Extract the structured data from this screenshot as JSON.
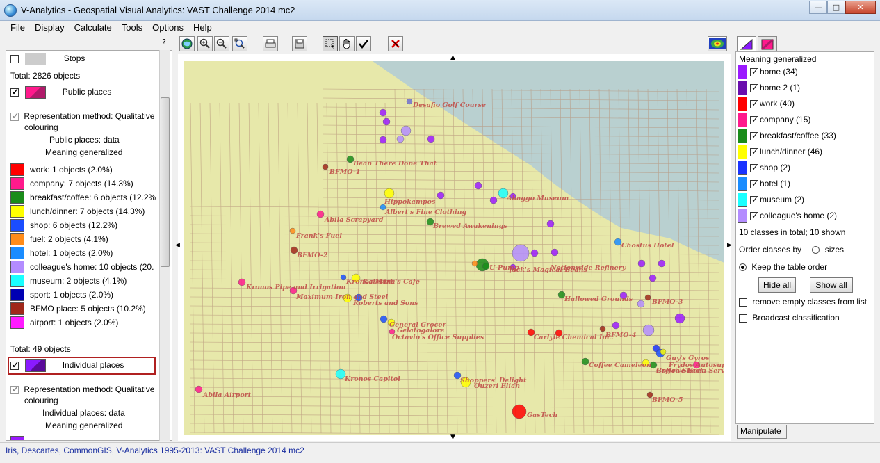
{
  "window": {
    "title": "V-Analytics - Geospatial Visual Analytics: VAST Challenge 2014 mc2",
    "controls": [
      "—",
      "□",
      "✕"
    ]
  },
  "menu": [
    "File",
    "Display",
    "Calculate",
    "Tools",
    "Options",
    "Help"
  ],
  "toolbar": {
    "help_label": "?",
    "buttons": [
      "globe-icon",
      "zoom-in-icon",
      "zoom-out-icon",
      "zoom-extent-icon",
      "print-icon",
      "save-icon",
      "select-rect-icon",
      "pan-hand-icon",
      "checkmark-icon",
      "no-select-icon",
      "overview-map-icon"
    ]
  },
  "left_panel": {
    "stops_label": "Stops",
    "stops_total": "Total: 2826 objects",
    "public_places_label": "Public places",
    "public_rep_method": "Representation method: Qualitative",
    "public_rep_method2": "colouring",
    "public_data": "Public places: data",
    "public_attr": "Meaning generalized",
    "public_legend": [
      {
        "color": "#ff0000",
        "label": "work: 1 objects (2.0%)"
      },
      {
        "color": "#ff1a8c",
        "label": "company: 7 objects (14.3%)"
      },
      {
        "color": "#1a8c1a",
        "label": "breakfast/coffee: 6 objects (12.2%"
      },
      {
        "color": "#ffff00",
        "label": "lunch/dinner: 7 objects (14.3%)"
      },
      {
        "color": "#1a4dff",
        "label": "shop: 6 objects (12.2%)"
      },
      {
        "color": "#ff8c1a",
        "label": "fuel: 2 objects (4.1%)"
      },
      {
        "color": "#1a8cff",
        "label": "hotel: 1 objects (2.0%)"
      },
      {
        "color": "#b38cff",
        "label": "colleague's home: 10 objects (20."
      },
      {
        "color": "#1affff",
        "label": "museum: 2 objects (4.1%)"
      },
      {
        "color": "#0000b3",
        "label": "sport: 1 objects (2.0%)"
      },
      {
        "color": "#a0281a",
        "label": "BFMO place: 5 objects (10.2%)"
      },
      {
        "color": "#ff1aff",
        "label": "airport: 1 objects (2.0%)"
      }
    ],
    "public_total": "Total: 49 objects",
    "individual_places_label": "Individual places",
    "indiv_rep_method": "Representation method: Qualitative",
    "indiv_rep_method2": "colouring",
    "indiv_data": "Individual places: data",
    "indiv_attr": "Meaning generalized"
  },
  "right_panel": {
    "title": "Meaning generalized",
    "classes": [
      {
        "color": "#9b1aff",
        "label": "home (34)"
      },
      {
        "color": "#6a0dad",
        "label": "home 2 (1)"
      },
      {
        "color": "#ff0000",
        "label": "work (40)"
      },
      {
        "color": "#ff1a8c",
        "label": "company (15)"
      },
      {
        "color": "#1a8c1a",
        "label": "breakfast/coffee (33)"
      },
      {
        "color": "#ffff00",
        "label": "lunch/dinner (46)"
      },
      {
        "color": "#1a33ff",
        "label": "shop (2)"
      },
      {
        "color": "#1a8cff",
        "label": "hotel (1)"
      },
      {
        "color": "#1affff",
        "label": "museum (2)"
      },
      {
        "color": "#b38cff",
        "label": "colleague's home (2)"
      }
    ],
    "summary": "10 classes in total; 10 shown",
    "order_label": "Order classes by",
    "sizes_label": "sizes",
    "keep_order_label": "Keep the table order",
    "hide_all": "Hide all",
    "show_all": "Show all",
    "remove_empty": "remove empty classes from list",
    "broadcast": "Broadcast classification",
    "manipulate_tab": "Manipulate"
  },
  "map": {
    "labels": [
      {
        "text": "Desafio Golf Course"
      },
      {
        "text": "Bean There Done That"
      },
      {
        "text": "BFMO-1"
      },
      {
        "text": "Hippokampos"
      },
      {
        "text": "Albert's Fine Clothing"
      },
      {
        "text": "Ahaggo Museum"
      },
      {
        "text": "Abila Scrapyard"
      },
      {
        "text": "Brewed Awakenings"
      },
      {
        "text": "Frank's Fuel"
      },
      {
        "text": "BFMO-2"
      },
      {
        "text": "Chostus Hotel"
      },
      {
        "text": "U-Pump"
      },
      {
        "text": "Jack's Magical Beans"
      },
      {
        "text": "Kronos Pipe and Irrigation"
      },
      {
        "text": "Maximum Iron and Steel"
      },
      {
        "text": "Kronos Mart"
      },
      {
        "text": "Katerina's Cafe"
      },
      {
        "text": "Nationwide Refinery"
      },
      {
        "text": "Roberts and Sons"
      },
      {
        "text": "Hallowed Grounds"
      },
      {
        "text": "BFMO-3"
      },
      {
        "text": "General Grocer"
      },
      {
        "text": "Gelatogalore"
      },
      {
        "text": "Octavio's Office Supplies"
      },
      {
        "text": "Carlyle Chemical Inc."
      },
      {
        "text": "BFMO-4"
      },
      {
        "text": "Guy's Gyros"
      },
      {
        "text": "Coffee Cameleon"
      },
      {
        "text": "Ouzeri Elian"
      },
      {
        "text": "Kronos Capitol"
      },
      {
        "text": "Shoppers' Delight"
      },
      {
        "text": "Brew've Been Served"
      },
      {
        "text": "Frydos Autosupply"
      },
      {
        "text": "Coffee Shack"
      },
      {
        "text": "Abila Airport"
      },
      {
        "text": "BFMO-5"
      },
      {
        "text": "GasTech"
      }
    ]
  },
  "status": {
    "text": "Iris, Descartes, CommonGIS, V-Analytics 1995-2013: VAST Challenge 2014 mc2"
  }
}
